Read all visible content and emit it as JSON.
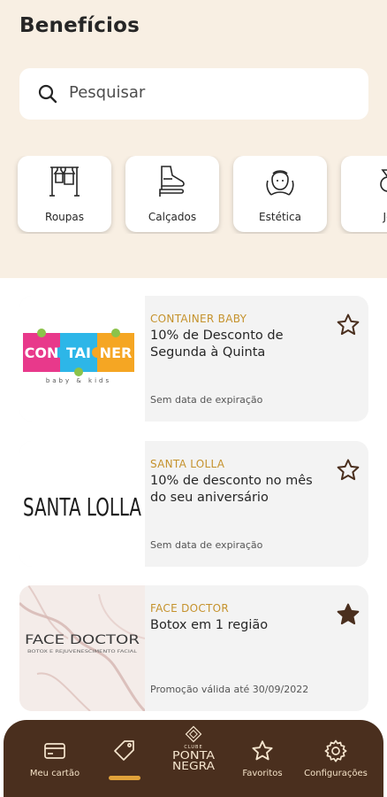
{
  "header": {
    "title": "Benefícios"
  },
  "search": {
    "placeholder": "Pesquisar"
  },
  "categories": [
    {
      "label": "Roupas",
      "icon": "clothes-rack-icon"
    },
    {
      "label": "Calçados",
      "icon": "shoes-icon"
    },
    {
      "label": "Estética",
      "icon": "face-care-icon"
    },
    {
      "label": "Jo",
      "icon": "jewelry-icon"
    }
  ],
  "offers": [
    {
      "brand": "CONTAINER BABY",
      "title": "10% de Desconto de Segunda à Quinta",
      "expiration": "Sem data de expiração",
      "favorite": false,
      "logo": {
        "word1": "CON",
        "word2": "TAI",
        "word3": "NER",
        "tagline": "baby & kids"
      }
    },
    {
      "brand": "SANTA LOLLA",
      "title": "10% de desconto no mês do seu aniversário",
      "expiration": "Sem data de expiração",
      "favorite": false,
      "logo": {
        "text": "SANTA LOLLA"
      }
    },
    {
      "brand": "FACE DOCTOR",
      "title": "Botox em 1 região",
      "expiration": "Promoção válida até 30/09/2022",
      "favorite": true,
      "logo": {
        "text": "FACE DOCTOR",
        "tagline": "BOTOX E REJUVENESCIMENTO FACIAL"
      }
    }
  ],
  "bottom_nav": {
    "items": [
      {
        "label": "Meu cartão",
        "icon": "card-icon"
      },
      {
        "label": "",
        "icon": "tag-icon",
        "active": true
      },
      {
        "label": "",
        "icon": "club-logo-icon",
        "logo_line1": "CLUBE",
        "logo_line2": "PONTA",
        "logo_line3": "NEGRA"
      },
      {
        "label": "Favoritos",
        "icon": "star-icon"
      },
      {
        "label": "Configurações",
        "icon": "gear-icon"
      }
    ]
  },
  "colors": {
    "header_bg": "#f8efe3",
    "accent": "#c5922c",
    "nav_bg": "#4a2f1e",
    "star_filled": "#4a2f1e",
    "indicator": "#e0a23a"
  }
}
